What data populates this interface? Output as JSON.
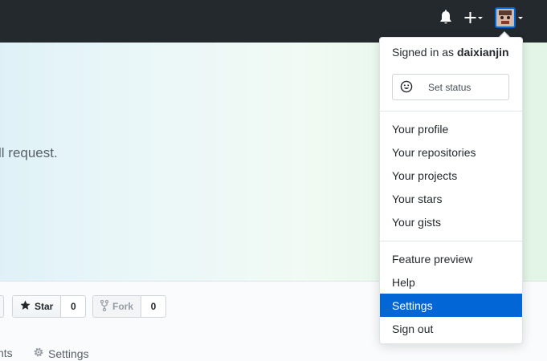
{
  "header": {
    "bell_icon": "bell-icon",
    "plus_icon": "plus-icon",
    "avatar": "user-avatar"
  },
  "hero": {
    "text": "ll request."
  },
  "repo": {
    "star": {
      "label": "Star",
      "count": "0",
      "icon": "star-icon"
    },
    "fork": {
      "label": "Fork",
      "count": "0",
      "icon": "fork-icon"
    },
    "tabs": {
      "partial": "nts",
      "settings": "Settings",
      "settings_icon": "gear-icon"
    }
  },
  "dropdown": {
    "signed_prefix": "Signed in as",
    "username": "daixianjin",
    "set_status": "Set status",
    "status_icon": "smiley-icon",
    "group1": [
      "Your profile",
      "Your repositories",
      "Your projects",
      "Your stars",
      "Your gists"
    ],
    "group2": [
      "Feature preview",
      "Help",
      "Settings",
      "Sign out"
    ],
    "active_item": "Settings"
  },
  "colors": {
    "header_bg": "#24292e",
    "active_bg": "#0366d6"
  }
}
